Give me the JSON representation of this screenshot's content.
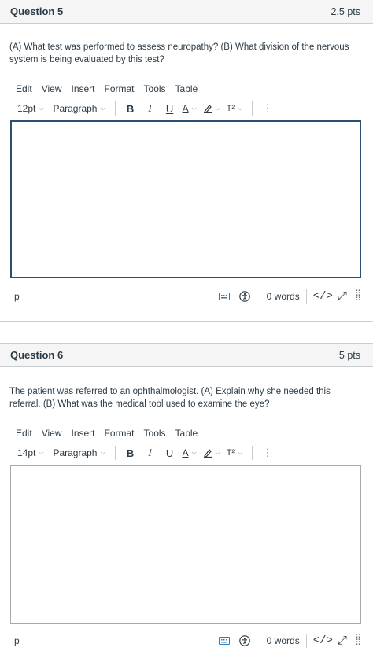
{
  "questions": [
    {
      "title": "Question 5",
      "points": "2.5 pts",
      "text": "(A) What test was performed to assess neuropathy? (B) What division of the nervous system is being evaluated by this test?",
      "font_size": "12pt",
      "block": "Paragraph",
      "path": "p",
      "words": "0 words"
    },
    {
      "title": "Question 6",
      "points": "5 pts",
      "text": "The patient was referred to an ophthalmologist. (A) Explain why she needed this referral. (B) What was the medical tool used to examine the eye?",
      "font_size": "14pt",
      "block": "Paragraph",
      "path": "p",
      "words": "0 words"
    }
  ],
  "menu": {
    "edit": "Edit",
    "view": "View",
    "insert": "Insert",
    "format": "Format",
    "tools": "Tools",
    "table": "Table"
  },
  "toolbar": {
    "bold": "B",
    "italic": "I",
    "underline": "U",
    "font_color": "A",
    "superscript": "T²",
    "more": "⋮"
  },
  "statusbar": {
    "code": "</>",
    "fullscreen": "⤢"
  },
  "colors": {
    "focus_border": "#2b4f6e",
    "text": "#2d3b45",
    "header_bg": "#f5f5f5",
    "accent": "#2b7abc"
  }
}
